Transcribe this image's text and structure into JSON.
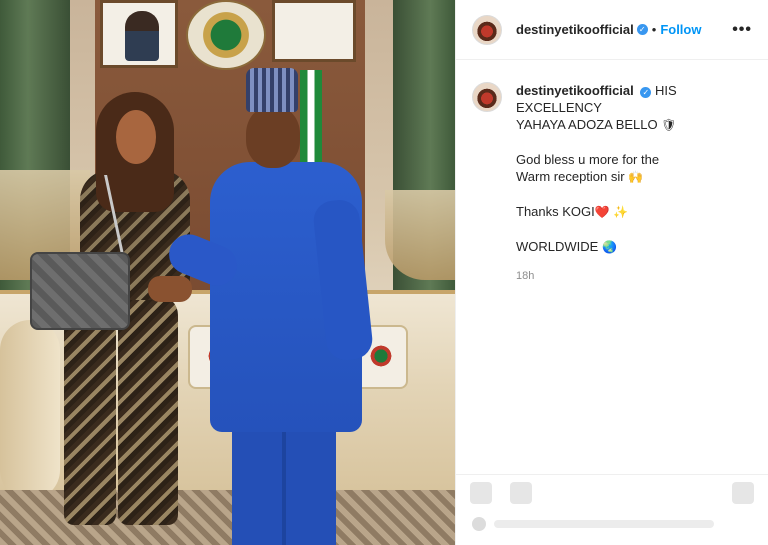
{
  "post": {
    "username": "destinyetikoofficial",
    "follow_label": "Follow",
    "separator": "•",
    "more_label": "•••",
    "verified_mark": "✓",
    "caption_lines": [
      "HIS",
      "EXCELLENCY",
      "YAHAYA ADOZA BELLO"
    ],
    "line_bless_1": "God bless u more for the",
    "line_bless_2": "Warm reception sir",
    "line_thanks": "Thanks KOGI",
    "line_worldwide": "WORLDWIDE",
    "time": "18h",
    "emoji": {
      "shield": "🛡",
      "reception": "🙌",
      "heart": "❤️",
      "sparkles": "✨",
      "globe": "🌏"
    }
  },
  "icons": {
    "like": "heart-icon",
    "comment": "comment-icon",
    "save": "bookmark-icon",
    "more": "ellipsis-icon"
  }
}
